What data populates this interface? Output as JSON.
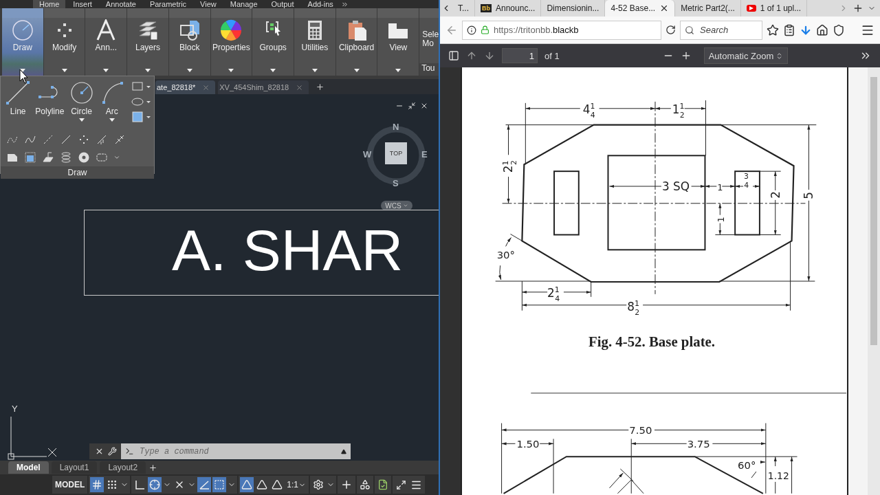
{
  "autocad": {
    "ribbon_tabs": [
      {
        "label": "Home",
        "selected": true
      },
      {
        "label": "Insert",
        "selected": false
      },
      {
        "label": "Annotate",
        "selected": false
      },
      {
        "label": "Parametric",
        "selected": false
      },
      {
        "label": "View",
        "selected": false
      },
      {
        "label": "Manage",
        "selected": false
      },
      {
        "label": "Output",
        "selected": false
      },
      {
        "label": "Add-ins",
        "selected": false
      }
    ],
    "ribbon_panels": [
      {
        "label": "Draw",
        "kind": "draw",
        "selected": true
      },
      {
        "label": "Modify",
        "kind": "modify",
        "selected": false
      },
      {
        "label": "Ann...",
        "kind": "annotation",
        "selected": false
      },
      {
        "label": "Layers",
        "kind": "layers",
        "selected": false
      },
      {
        "label": "Block",
        "kind": "block",
        "selected": false
      },
      {
        "label": "Properties",
        "kind": "properties",
        "selected": false
      },
      {
        "label": "Groups",
        "kind": "groups",
        "selected": false
      },
      {
        "label": "Utilities",
        "kind": "utilities",
        "selected": false
      },
      {
        "label": "Clipboard",
        "kind": "clipboard",
        "selected": false
      },
      {
        "label": "View",
        "kind": "view",
        "selected": false
      }
    ],
    "partial_panel": {
      "label": "Sele Mo",
      "footer": "Tou"
    },
    "draw_flyout": {
      "title": "Draw",
      "tools": [
        {
          "label": "Line",
          "kind": "line",
          "dropdown": false
        },
        {
          "label": "Polyline",
          "kind": "polyline",
          "dropdown": false
        },
        {
          "label": "Circle",
          "kind": "circle",
          "dropdown": true
        },
        {
          "label": "Arc",
          "kind": "arc",
          "dropdown": true
        }
      ]
    },
    "file_tabs": [
      {
        "label": "ate_82818*",
        "selected": true
      },
      {
        "label": "XV_454Shim_82818",
        "selected": false
      }
    ],
    "viewcube": {
      "north": "N",
      "south": "S",
      "east": "E",
      "west": "W",
      "face": "TOP",
      "ucs": "WCS"
    },
    "title_text": "A. SHAR",
    "ucs_label": "Y",
    "command": {
      "placeholder": "Type a command"
    },
    "layout_tabs": [
      {
        "label": "Model",
        "selected": true
      },
      {
        "label": "Layout1",
        "selected": false
      },
      {
        "label": "Layout2",
        "selected": false
      }
    ],
    "status": {
      "model": "MODEL",
      "scale": "1:1",
      "toggles": [
        {
          "kind": "grid",
          "on": true
        },
        {
          "kind": "snap",
          "on": false
        },
        {
          "kind": "ortho",
          "on": false
        },
        {
          "kind": "polar",
          "on": true
        },
        {
          "kind": "isodraft",
          "on": false
        },
        {
          "kind": "track",
          "on": true
        },
        {
          "kind": "osnap",
          "on": true
        },
        {
          "kind": "annovis",
          "on": true
        },
        {
          "kind": "autoscale",
          "on": false
        },
        {
          "kind": "annoscale",
          "on": false
        }
      ]
    }
  },
  "browser": {
    "tabs": [
      {
        "label": "T...",
        "kind": "plain",
        "selected": false
      },
      {
        "label": "Announc...",
        "kind": "plain",
        "badge": "Bb",
        "selected": false
      },
      {
        "label": "Dimensionin...",
        "kind": "plain",
        "selected": false
      },
      {
        "label": "4-52 Base...",
        "kind": "plain",
        "selected": true
      },
      {
        "label": "Metric Part2(...",
        "kind": "plain",
        "selected": false
      },
      {
        "label": "1 of 1 upl...",
        "kind": "video",
        "selected": false
      }
    ],
    "url_prefix": "https://tritonbb.",
    "url_domain": "blackb",
    "search": {
      "placeholder": "Search"
    },
    "pdf_toolbar": {
      "page": "1",
      "of": "of 1",
      "zoom": "Automatic Zoom"
    },
    "figures": [
      {
        "kind": "base-plate",
        "caption": "Fig. 4-52. Base plate.",
        "labels": [
          {
            "whole": "4",
            "num": "1",
            "den": "4"
          },
          {
            "whole": "1",
            "num": "1",
            "den": "2"
          },
          {
            "whole": "2",
            "num": "1",
            "den": "2"
          },
          {
            "whole": "5"
          },
          {
            "whole": "3 SQ"
          },
          {
            "whole": "1"
          },
          {
            "num": "3",
            "den": "4"
          },
          {
            "whole": "2"
          },
          {
            "whole": "1"
          },
          {
            "whole": "30°"
          },
          {
            "whole": "2",
            "num": "1",
            "den": "4"
          },
          {
            "whole": "8",
            "num": "1",
            "den": "2"
          }
        ]
      },
      {
        "kind": "trapezoid",
        "labels": [
          {
            "whole": "7.50"
          },
          {
            "whole": "1.50"
          },
          {
            "whole": "3.75"
          },
          {
            "whole": "60°"
          },
          {
            "whole": "1.12"
          }
        ]
      }
    ]
  }
}
